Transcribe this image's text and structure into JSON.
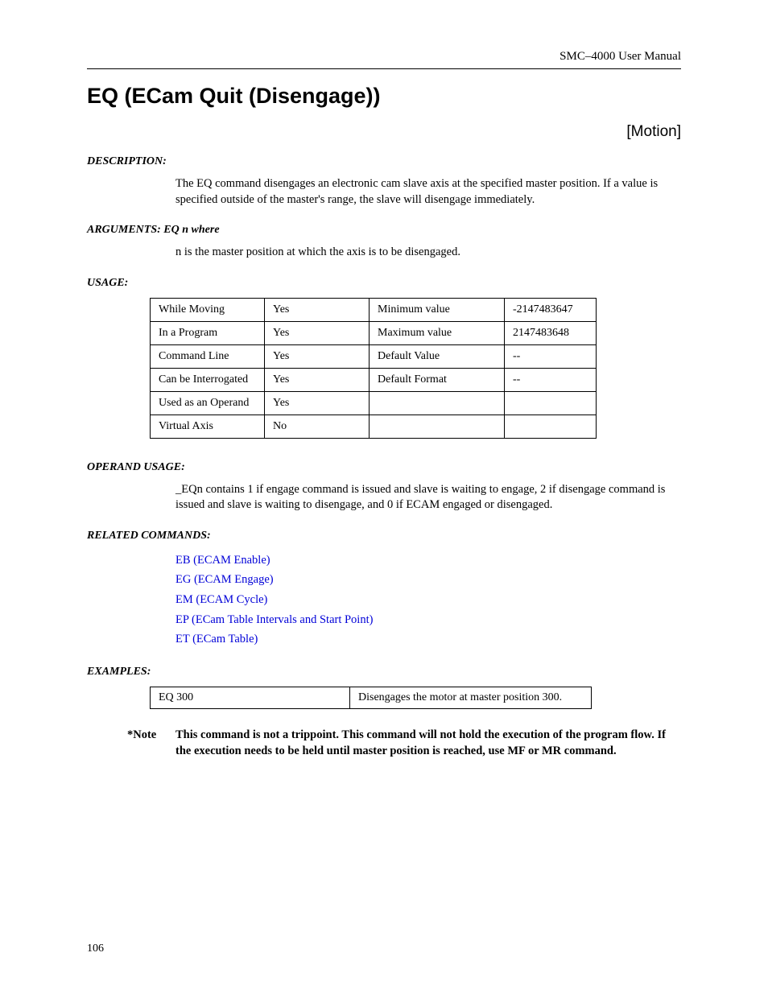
{
  "header": {
    "manual": "SMC–4000 User Manual"
  },
  "title": "EQ (ECam Quit (Disengage))",
  "category": "[Motion]",
  "description": {
    "label": "DESCRIPTION:",
    "text": "The EQ command disengages an electronic cam slave axis at the specified master position. If a value is specified outside of the master's range, the slave will disengage immediately."
  },
  "arguments": {
    "label": "ARGUMENTS: EQ  n         where",
    "text": "n is the master position at which the axis is to be disengaged."
  },
  "usage": {
    "label": "USAGE:",
    "rows": [
      [
        "While Moving",
        "Yes",
        "Minimum value",
        "-2147483647"
      ],
      [
        "In a Program",
        "Yes",
        "Maximum value",
        "2147483648"
      ],
      [
        "Command Line",
        "Yes",
        "Default Value",
        "--"
      ],
      [
        "Can be Interrogated",
        "Yes",
        "Default Format",
        "--"
      ],
      [
        "Used as an Operand",
        "Yes",
        "",
        ""
      ],
      [
        "Virtual Axis",
        "No",
        "",
        ""
      ]
    ]
  },
  "operand_usage": {
    "label": "OPERAND USAGE:",
    "text": "_EQn contains 1 if engage command is issued and slave is waiting to engage, 2 if disengage command is issued and slave is waiting to disengage, and 0 if ECAM engaged or disengaged."
  },
  "related": {
    "label": "RELATED COMMANDS:",
    "items": [
      "EB (ECAM Enable)",
      "EG (ECAM Engage)",
      "EM (ECAM Cycle)",
      "EP (ECam Table Intervals and Start Point)",
      "ET (ECam Table)"
    ]
  },
  "examples": {
    "label": "EXAMPLES:",
    "rows": [
      [
        "EQ 300",
        "Disengages the motor at master position 300."
      ]
    ]
  },
  "note": {
    "label": "*Note",
    "text": "This command is not a trippoint. This command will not hold the execution of the program flow. If the execution needs to be held until master position is reached, use MF or MR command."
  },
  "page_number": "106"
}
